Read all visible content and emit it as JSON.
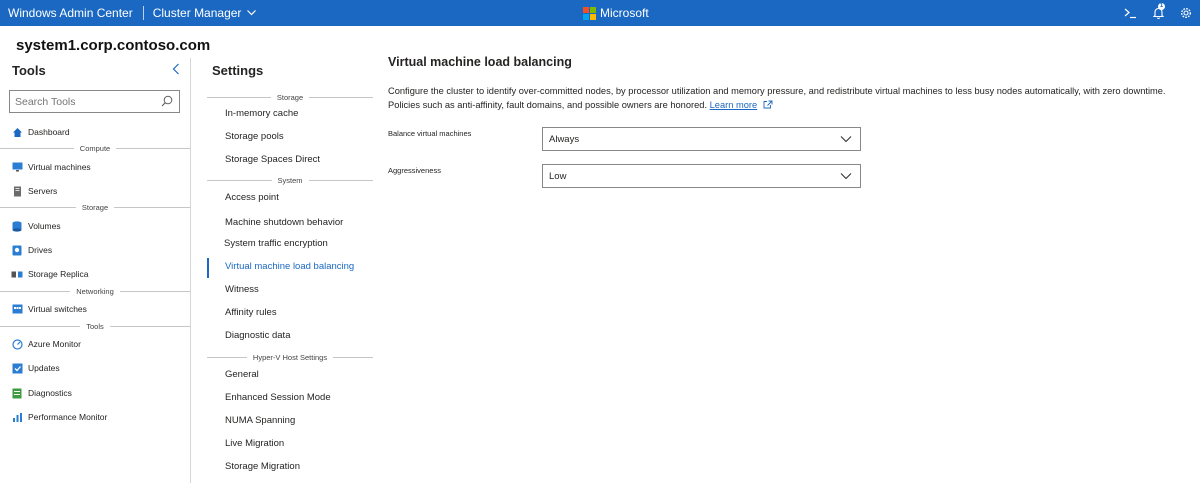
{
  "topbar": {
    "app_title": "Windows Admin Center",
    "manager": "Cluster Manager",
    "brand": "Microsoft",
    "notification_count": "1",
    "icons": [
      "terminal-icon",
      "bell-icon",
      "gear-icon"
    ]
  },
  "server_name": "system1.corp.contoso.com",
  "tools": {
    "title": "Tools",
    "search_placeholder": "Search Tools",
    "items": [
      {
        "type": "item",
        "label": "Dashboard",
        "icon": "home-icon"
      },
      {
        "type": "header",
        "label": "Compute"
      },
      {
        "type": "item",
        "label": "Virtual machines",
        "icon": "vm-icon"
      },
      {
        "type": "item",
        "label": "Servers",
        "icon": "server-icon"
      },
      {
        "type": "header",
        "label": "Storage"
      },
      {
        "type": "item",
        "label": "Volumes",
        "icon": "volume-icon"
      },
      {
        "type": "item",
        "label": "Drives",
        "icon": "drive-icon"
      },
      {
        "type": "item",
        "label": "Storage Replica",
        "icon": "replica-icon"
      },
      {
        "type": "header",
        "label": "Networking"
      },
      {
        "type": "item",
        "label": "Virtual switches",
        "icon": "switch-icon"
      },
      {
        "type": "header",
        "label": "Tools"
      },
      {
        "type": "item",
        "label": "Azure Monitor",
        "icon": "azure-monitor-icon"
      },
      {
        "type": "item",
        "label": "Updates",
        "icon": "updates-icon"
      },
      {
        "type": "item",
        "label": "Diagnostics",
        "icon": "diagnostics-icon"
      },
      {
        "type": "item",
        "label": "Performance Monitor",
        "icon": "performance-icon"
      }
    ]
  },
  "settings": {
    "title": "Settings",
    "sections": [
      {
        "header": "Storage",
        "items": [
          "In-memory cache",
          "Storage pools",
          "Storage Spaces Direct"
        ]
      },
      {
        "header": "System",
        "items": [
          "Access point",
          "Machine shutdown behavior",
          "System traffic encryption",
          "Virtual machine load balancing",
          "Witness",
          "Affinity rules",
          "Diagnostic data"
        ]
      },
      {
        "header": "Hyper-V Host Settings",
        "items": [
          "General",
          "Enhanced Session Mode",
          "NUMA Spanning",
          "Live Migration",
          "Storage Migration"
        ]
      }
    ],
    "active_item": "Virtual machine load balancing"
  },
  "main": {
    "title": "Virtual machine load balancing",
    "description": "Configure the cluster to identify over-committed nodes, by processor utilization and memory pressure, and redistribute virtual machines to less busy nodes automatically, with zero downtime. Policies such as anti-affinity, fault domains, and possible owners are honored.",
    "learn_more": "Learn more",
    "fields": [
      {
        "label": "Balance virtual machines",
        "value": "Always"
      },
      {
        "label": "Aggressiveness",
        "value": "Low"
      }
    ]
  },
  "colors": {
    "accent": "#1a68c2"
  }
}
